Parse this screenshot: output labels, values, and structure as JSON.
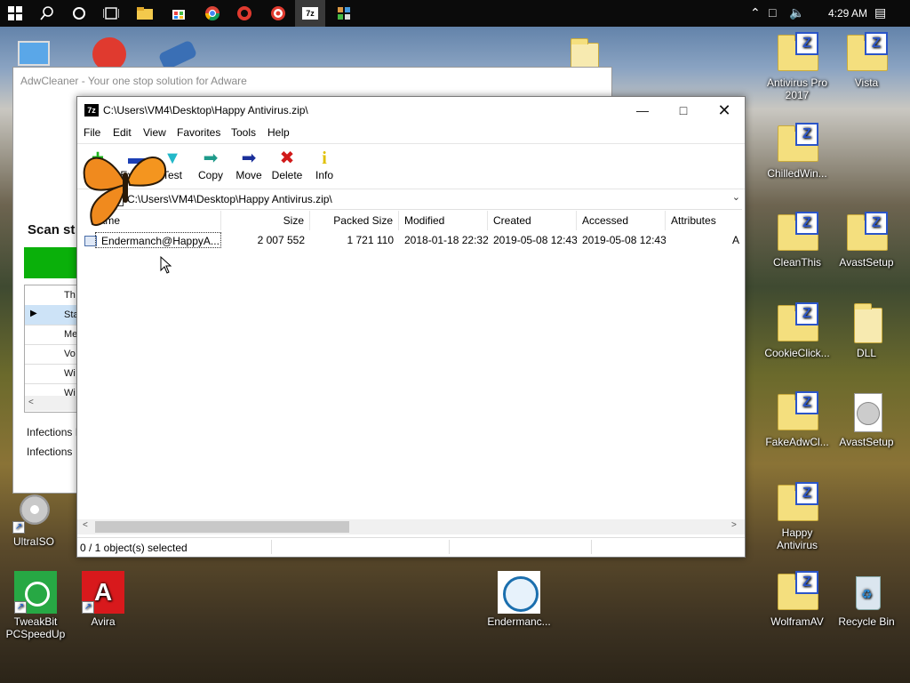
{
  "taskbar": {
    "clock": "4:29 AM"
  },
  "desktop_icons": [
    {
      "id": "antivirus-pro-2017",
      "label": "Antivirus Pro 2017",
      "type": "zip-folder"
    },
    {
      "id": "vista",
      "label": "Vista",
      "type": "zip-folder"
    },
    {
      "id": "chilledwin",
      "label": "ChilledWin...",
      "type": "zip-folder"
    },
    {
      "id": "cleanthis",
      "label": "CleanThis",
      "type": "zip-folder"
    },
    {
      "id": "avastsetup-1",
      "label": "AvastSetup",
      "type": "zip-folder"
    },
    {
      "id": "cookieclick",
      "label": "CookieClick...",
      "type": "zip-folder"
    },
    {
      "id": "dll",
      "label": "DLL",
      "type": "folder"
    },
    {
      "id": "fakeadwcl",
      "label": "FakeAdwCl...",
      "type": "zip-folder"
    },
    {
      "id": "avastsetup-2",
      "label": "AvastSetup",
      "type": "disc"
    },
    {
      "id": "happy-antivirus",
      "label": "Happy Antivirus",
      "type": "zip-folder"
    },
    {
      "id": "wolframav",
      "label": "WolframAV",
      "type": "zip-folder"
    },
    {
      "id": "recycle-bin",
      "label": "Recycle Bin",
      "type": "recycle"
    },
    {
      "id": "ultraiso",
      "label": "UltraISO",
      "type": "disc"
    },
    {
      "id": "tweakbit",
      "label": "TweakBit PCSpeedUp",
      "type": "app"
    },
    {
      "id": "avira",
      "label": "Avira",
      "type": "app"
    },
    {
      "id": "endermanch",
      "label": "Endermanc...",
      "type": "app"
    }
  ],
  "adwcleaner": {
    "title": "AdwCleaner - Your one stop solution for Adware",
    "scan_label": "Scan st",
    "grid_header": "Th",
    "grid_rows": [
      "Sta",
      "Me",
      "Vo",
      "Wi",
      "Wi"
    ],
    "infections_1": "Infections I",
    "infections_2": "Infections"
  },
  "sevenzip": {
    "title": "C:\\Users\\VM4\\Desktop\\Happy Antivirus.zip\\",
    "menu": [
      "File",
      "Edit",
      "View",
      "Favorites",
      "Tools",
      "Help"
    ],
    "toolbar": [
      "Add",
      "Extract",
      "Test",
      "Copy",
      "Move",
      "Delete",
      "Info"
    ],
    "address": "C:\\Users\\VM4\\Desktop\\Happy Antivirus.zip\\",
    "columns": [
      "Name",
      "Size",
      "Packed Size",
      "Modified",
      "Created",
      "Accessed",
      "Attributes"
    ],
    "files": [
      {
        "name": "Endermanch@HappyA...",
        "size": "2 007 552",
        "packed_size": "1 721 110",
        "modified": "2018-01-18 22:32",
        "created": "2019-05-08 12:43",
        "accessed": "2019-05-08 12:43",
        "attributes": "A"
      }
    ],
    "status": "0 / 1 object(s) selected"
  }
}
